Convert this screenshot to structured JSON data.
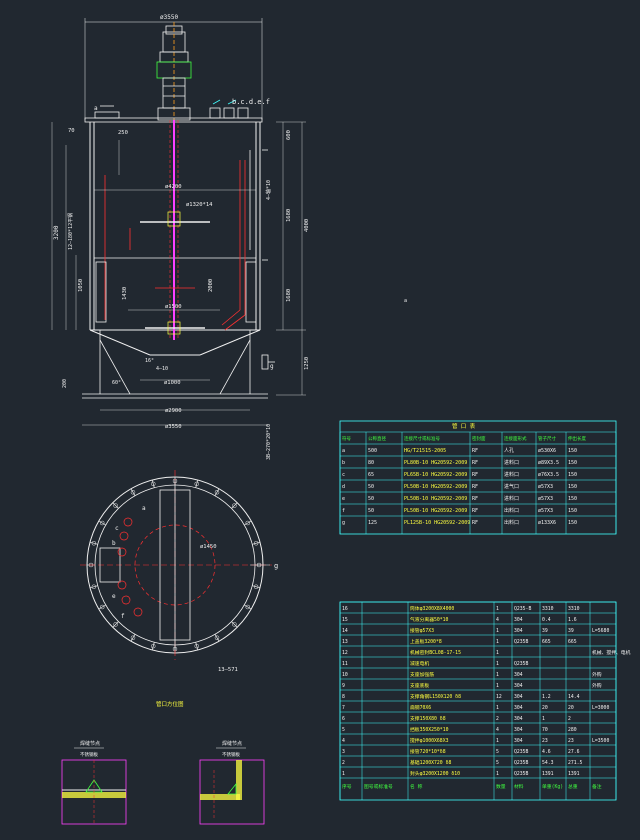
{
  "colors": {
    "background": "#212830",
    "white": "#f0f0f0",
    "yellow": "#ffff40",
    "green": "#40ff40",
    "cyan": "#40ffff",
    "red": "#ff3030",
    "magenta": "#ff40ff",
    "orange": "#ffa020"
  },
  "elevation": {
    "dim_top_width": "ø3550",
    "dim_250": "250",
    "dim_70": "70",
    "dim_600": "600",
    "dim_1680a": "1680",
    "dim_1680b": "1680",
    "dim_4000": "4000",
    "dim_1250": "1250",
    "dim_3200": "3200",
    "dim_1050": "1050",
    "dim_1430": "1430",
    "dim_2000": "2000",
    "dim_4200": "ø4200",
    "dim_1500": "ø1500",
    "dim_1000": "ø1000",
    "dim_2900": "ø2900",
    "dim_3550b": "ø3550",
    "dim_60": "60°",
    "dim_16": "16°",
    "dim_4_10": "4—10",
    "dim_200": "200",
    "note_impeller": "ø1320*14",
    "vertical_note_left": "12—180*12平钢",
    "vertical_note_right": "4—轴*10",
    "vertical_note_side": "3B—270*20*10",
    "nozzle_letters": "b.c.d.e.f",
    "label_a": "a",
    "label_g": "g",
    "label_d": "d"
  },
  "plan": {
    "dim_1450": "ø1450",
    "dim_13_571": "13—571",
    "label_g": "g",
    "label_f": "f",
    "label_a": "a",
    "label_b": "b",
    "label_c": "c",
    "label_e": "e",
    "title": "管口方位图"
  },
  "nozzle_table": {
    "title": "管 口 表",
    "headers": [
      "符号",
      "公称直径",
      "连接尺寸或标准号",
      "密封面",
      "连接面形式",
      "管子尺寸",
      "伸出长度"
    ],
    "rows": [
      [
        "a",
        "500",
        "HG/T21515-2005",
        "RF",
        "人孔",
        "ø530X6",
        "150"
      ],
      [
        "b",
        "80",
        "PL80B-10 HG20592-2009",
        "RF",
        "进料口",
        "ø89X3.5",
        "150"
      ],
      [
        "c",
        "65",
        "PL65B-10 HG20592-2009",
        "RF",
        "进料口",
        "ø76X3.5",
        "150"
      ],
      [
        "d",
        "50",
        "PL50B-10 HG20592-2009",
        "RF",
        "进气口",
        "ø57X3",
        "150"
      ],
      [
        "e",
        "50",
        "PL50B-10 HG20592-2009",
        "RF",
        "进料口",
        "ø57X3",
        "150"
      ],
      [
        "f",
        "50",
        "PL50B-10 HG20592-2009",
        "RF",
        "出料口",
        "ø57X3",
        "150"
      ],
      [
        "g",
        "125",
        "PL125B-10 HG20592-2009",
        "RF",
        "出料口",
        "ø133X6",
        "150"
      ]
    ]
  },
  "parts_table": {
    "rows": [
      [
        "16",
        "",
        "筒体φ3200X8X4000",
        "1",
        "Q235-B",
        "3310",
        "3310",
        "",
        ""
      ],
      [
        "15",
        "",
        "气液分离器50*10",
        "4",
        "304",
        "0.4",
        "1.6",
        "",
        ""
      ],
      [
        "14",
        "",
        "接管φ57X3",
        "1",
        "304",
        "39",
        "39",
        "L=5680",
        ""
      ],
      [
        "13",
        "",
        "上盖板3200*8",
        "1",
        "Q235B",
        "665",
        "665",
        "",
        ""
      ],
      [
        "12",
        "",
        "机械密封BCL08-17-15",
        "1",
        "",
        "",
        "",
        "机械、搅拌、电机",
        ""
      ],
      [
        "11",
        "",
        "减速电机",
        "1",
        "Q235B",
        "",
        "",
        "",
        ""
      ],
      [
        "10",
        "",
        "支座加强筋",
        "1",
        "304",
        "",
        "",
        "外购",
        ""
      ],
      [
        "9",
        "",
        "支座底板",
        "1",
        "304",
        "",
        "",
        "外购",
        ""
      ],
      [
        "8",
        "",
        "支撑角钢L150X120  δ8",
        "12",
        "304",
        "1.2",
        "14.4",
        "",
        ""
      ],
      [
        "7",
        "",
        "扁钢70X6",
        "1",
        "304",
        "20",
        "20",
        "L=3000",
        ""
      ],
      [
        "6",
        "",
        "支撑150X80  δ8",
        "2",
        "304",
        "1",
        "2",
        "",
        ""
      ],
      [
        "5",
        "",
        "挡板350X250*10",
        "4",
        "304",
        "70",
        "280",
        "",
        ""
      ],
      [
        "4",
        "",
        "搅拌φ1000X68X3",
        "1",
        "304",
        "23",
        "23",
        "L=3500",
        ""
      ],
      [
        "3",
        "",
        "接管720*10*δ8",
        "5",
        "Q235B",
        "4.6",
        "27.6",
        "",
        ""
      ],
      [
        "2",
        "",
        "基础1200X720  δ8",
        "5",
        "Q235B",
        "54.3",
        "271.5",
        "",
        ""
      ],
      [
        "1",
        "",
        "封头φ3200X1200  δ10",
        "1",
        "Q235B",
        "1391",
        "1391",
        "",
        ""
      ]
    ],
    "footer": [
      "序号",
      "图号或标准号",
      "名 称",
      "数量",
      "材料",
      "单重(Kg)",
      "总重",
      "备注"
    ]
  },
  "details": {
    "left_title": "焊缝节点",
    "left_sub": "不锈钢板",
    "right_title": "焊缝节点",
    "right_sub": "不锈钢板"
  },
  "misc": {
    "dot_label": "a"
  }
}
